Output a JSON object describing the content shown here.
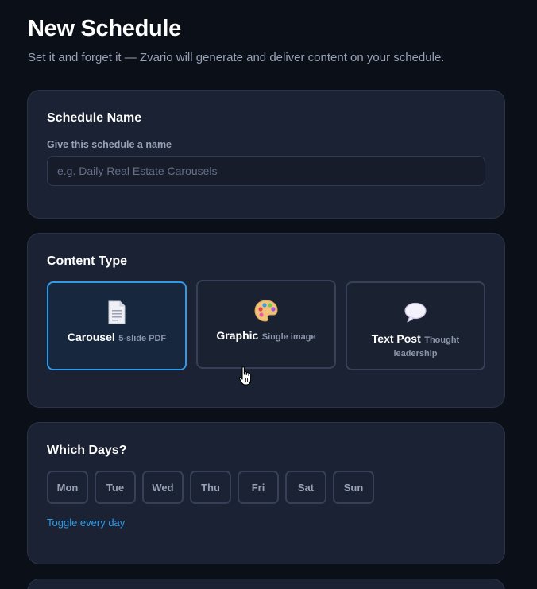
{
  "header": {
    "title": "New Schedule",
    "subtitle": "Set it and forget it — Zvario will generate and deliver content on your schedule."
  },
  "schedule_name": {
    "title": "Schedule Name",
    "label": "Give this schedule a name",
    "value": "",
    "placeholder": "e.g. Daily Real Estate Carousels"
  },
  "content_type": {
    "title": "Content Type",
    "selected": "carousel",
    "options": [
      {
        "id": "carousel",
        "name": "Carousel",
        "sub": "5-slide PDF",
        "icon": "document-icon"
      },
      {
        "id": "graphic",
        "name": "Graphic",
        "sub": "Single image",
        "icon": "palette-icon"
      },
      {
        "id": "text_post",
        "name": "Text Post",
        "sub": "Thought leadership",
        "icon": "speech-bubble-icon"
      }
    ]
  },
  "days": {
    "title": "Which Days?",
    "items": [
      "Mon",
      "Tue",
      "Wed",
      "Thu",
      "Fri",
      "Sat",
      "Sun"
    ],
    "toggle_label": "Toggle every day"
  },
  "colors": {
    "background": "#0b0f17",
    "card": "#1b2233",
    "accent": "#2f9be8",
    "muted_text": "#98a2b6"
  }
}
